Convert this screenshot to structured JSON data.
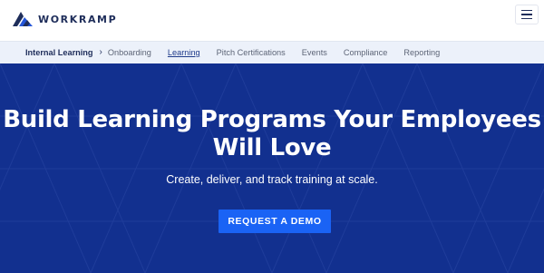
{
  "header": {
    "logo_text": "WORKRAMP",
    "logo_icon": "workramp-mark-icon",
    "menu_icon": "hamburger-menu-icon"
  },
  "subnav": {
    "breadcrumb_root": "Internal Learning",
    "separator_icon": "chevron-right-icon",
    "items": [
      {
        "label": "Onboarding",
        "active": false
      },
      {
        "label": "Learning",
        "active": true
      },
      {
        "label": "Pitch Certifications",
        "active": false
      },
      {
        "label": "Events",
        "active": false
      },
      {
        "label": "Compliance",
        "active": false
      },
      {
        "label": "Reporting",
        "active": false
      }
    ]
  },
  "hero": {
    "title_line1": "Build Learning Programs Your Employees",
    "title_line2": "Will Love",
    "subtitle": "Create, deliver, and track training at scale.",
    "cta_label": "REQUEST A DEMO"
  },
  "colors": {
    "brand_navy": "#1e2d5a",
    "hero_background": "#12308f",
    "cta_blue": "#1a63f5",
    "subnav_background": "#ecf1fa"
  }
}
